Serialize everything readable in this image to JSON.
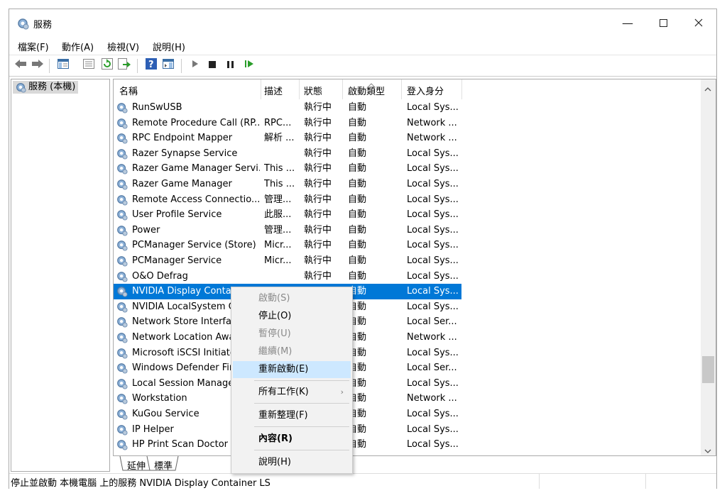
{
  "window": {
    "title": "服務"
  },
  "menubar": [
    "檔案(F)",
    "動作(A)",
    "檢視(V)",
    "說明(H)"
  ],
  "tree": {
    "node_label": "服務 (本機)"
  },
  "list": {
    "columns": [
      "名稱",
      "描述",
      "狀態",
      "啟動類型",
      "登入身分"
    ],
    "rows": [
      {
        "name": "RunSwUSB",
        "desc": "",
        "status": "執行中",
        "startup": "自動",
        "logon": "Local Sys..."
      },
      {
        "name": "Remote Procedure Call (RP...",
        "desc": "RPC...",
        "status": "執行中",
        "startup": "自動",
        "logon": "Network ..."
      },
      {
        "name": "RPC Endpoint Mapper",
        "desc": "解析 ...",
        "status": "執行中",
        "startup": "自動",
        "logon": "Network ..."
      },
      {
        "name": "Razer Synapse Service",
        "desc": "",
        "status": "執行中",
        "startup": "自動",
        "logon": "Local Sys..."
      },
      {
        "name": "Razer Game Manager Servi...",
        "desc": "This ...",
        "status": "執行中",
        "startup": "自動",
        "logon": "Local Sys..."
      },
      {
        "name": "Razer Game Manager",
        "desc": "This ...",
        "status": "執行中",
        "startup": "自動",
        "logon": "Local Sys..."
      },
      {
        "name": "Remote Access Connectio...",
        "desc": "管理...",
        "status": "執行中",
        "startup": "自動",
        "logon": "Local Sys..."
      },
      {
        "name": "User Profile Service",
        "desc": "此服...",
        "status": "執行中",
        "startup": "自動",
        "logon": "Local Sys..."
      },
      {
        "name": "Power",
        "desc": "管理...",
        "status": "執行中",
        "startup": "自動",
        "logon": "Local Sys..."
      },
      {
        "name": "PCManager Service (Store)",
        "desc": "Micr...",
        "status": "執行中",
        "startup": "自動",
        "logon": "Local Sys..."
      },
      {
        "name": "PCManager Service",
        "desc": "Micr...",
        "status": "執行中",
        "startup": "自動",
        "logon": "Local Sys..."
      },
      {
        "name": "O&O Defrag",
        "desc": "",
        "status": "執行中",
        "startup": "自動",
        "logon": "Local Sys..."
      },
      {
        "name": "NVIDIA Display Container LS",
        "desc": "",
        "status": "",
        "startup": "自動",
        "logon": "Local Sys...",
        "selected": true
      },
      {
        "name": "NVIDIA LocalSystem Co",
        "desc": "",
        "status": "",
        "startup": "自動",
        "logon": "Local Sys..."
      },
      {
        "name": "Network Store Interface",
        "desc": "",
        "status": "",
        "startup": "自動",
        "logon": "Local Ser..."
      },
      {
        "name": "Network Location Awar",
        "desc": "",
        "status": "",
        "startup": "自動",
        "logon": "Network ..."
      },
      {
        "name": "Microsoft iSCSI Initiator",
        "desc": "",
        "status": "",
        "startup": "自動",
        "logon": "Local Sys..."
      },
      {
        "name": "Windows Defender Fire",
        "desc": "",
        "status": "",
        "startup": "自動",
        "logon": "Local Ser..."
      },
      {
        "name": "Local Session Manager",
        "desc": "",
        "status": "",
        "startup": "自動",
        "logon": "Local Sys..."
      },
      {
        "name": "Workstation",
        "desc": "",
        "status": "",
        "startup": "自動",
        "logon": "Network ..."
      },
      {
        "name": "KuGou Service",
        "desc": "",
        "status": "",
        "startup": "自動",
        "logon": "Local Sys..."
      },
      {
        "name": "IP Helper",
        "desc": "",
        "status": "",
        "startup": "自動",
        "logon": "Local Sys..."
      },
      {
        "name": "HP Print Scan Doctor S",
        "desc": "",
        "status": "",
        "startup": "自動",
        "logon": "Local Sys..."
      }
    ]
  },
  "tabs": [
    "延伸",
    "標準"
  ],
  "context_menu": [
    {
      "label": "啟動(S)",
      "disabled": true
    },
    {
      "label": "停止(O)"
    },
    {
      "label": "暫停(U)",
      "disabled": true
    },
    {
      "label": "繼續(M)",
      "disabled": true
    },
    {
      "label": "重新啟動(E)",
      "highlighted": true
    },
    {
      "label": "所有工作(K)",
      "submenu": true
    },
    {
      "label": "重新整理(F)"
    },
    {
      "label": "內容(R)",
      "bold": true
    },
    {
      "label": "說明(H)"
    }
  ],
  "status": {
    "text": "停止並啟動 本機電腦 上的服務 NVIDIA Display Container LS"
  },
  "colors": {
    "selection": "#0078d7",
    "menu_highlight": "#cde8ff"
  }
}
